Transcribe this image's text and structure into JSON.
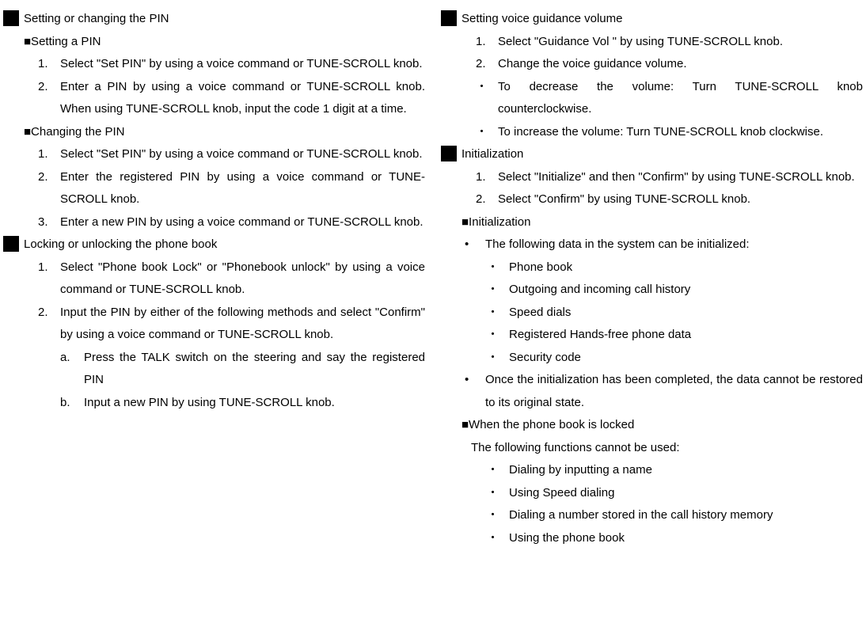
{
  "left": {
    "section1": {
      "title": "Setting or changing the PIN",
      "sub1": {
        "title": "■Setting a PIN",
        "items": [
          {
            "num": "1.",
            "text": "Select \"Set PIN\" by using a voice command or TUNE-SCROLL knob."
          },
          {
            "num": "2.",
            "text": "Enter a PIN by using a voice command or TUNE-SCROLL knob. When using TUNE-SCROLL knob, input the code 1 digit at a time."
          }
        ]
      },
      "sub2": {
        "title": "■Changing the PIN",
        "items": [
          {
            "num": "1.",
            "text": "Select \"Set PIN\" by using a voice command or TUNE-SCROLL knob."
          },
          {
            "num": "2.",
            "text": "Enter the registered PIN by using a voice command or TUNE-SCROLL knob."
          },
          {
            "num": "3.",
            "text": "Enter a new PIN by using a voice command or TUNE-SCROLL knob."
          }
        ]
      }
    },
    "section2": {
      "title": "Locking or unlocking the phone book",
      "items": [
        {
          "num": "1.",
          "text": "Select \"Phone book Lock\" or \"Phonebook unlock\" by using a voice command or TUNE-SCROLL knob."
        },
        {
          "num": "2.",
          "text": "Input the PIN by either of the following methods and select \"Confirm\" by using a voice command or TUNE-SCROLL knob."
        }
      ],
      "subitems": [
        {
          "letter": "a.",
          "text": "Press the TALK switch on the steering and say the registered PIN"
        },
        {
          "letter": "b.",
          "text": "Input a new PIN by using TUNE-SCROLL knob."
        }
      ]
    }
  },
  "right": {
    "section1": {
      "title": "Setting voice guidance volume",
      "items": [
        {
          "num": "1.",
          "text": "Select \"Guidance Vol \" by using TUNE-SCROLL knob."
        },
        {
          "num": "2.",
          "text": "Change the voice guidance volume."
        }
      ],
      "bullets": [
        {
          "text": "To decrease the volume:        Turn  TUNE-SCROLL knob counterclockwise."
        },
        {
          "text": "To increase the volume:       Turn  TUNE-SCROLL knob clockwise."
        }
      ]
    },
    "section2": {
      "title": "Initialization",
      "items": [
        {
          "num": "1.",
          "text": "Select \"Initialize\" and then \"Confirm\" by using TUNE-SCROLL knob."
        },
        {
          "num": "2.",
          "text": "Select \"Confirm\" by using TUNE-SCROLL knob."
        }
      ],
      "sub1": {
        "title": "■Initialization",
        "bullet1": "The following data in the system can be initialized:",
        "subbullets": [
          "Phone book",
          "Outgoing and incoming call history",
          "Speed dials",
          "Registered Hands-free phone data",
          "Security code"
        ],
        "bullet2": "Once the initialization has been completed, the data cannot be restored to its original state."
      },
      "sub2": {
        "title": "■When the phone book is locked",
        "intro": "The following functions cannot be used:",
        "subbullets": [
          "Dialing by inputting a name",
          "Using Speed dialing",
          "Dialing a number stored in the call history memory",
          "Using the phone book"
        ]
      }
    }
  }
}
